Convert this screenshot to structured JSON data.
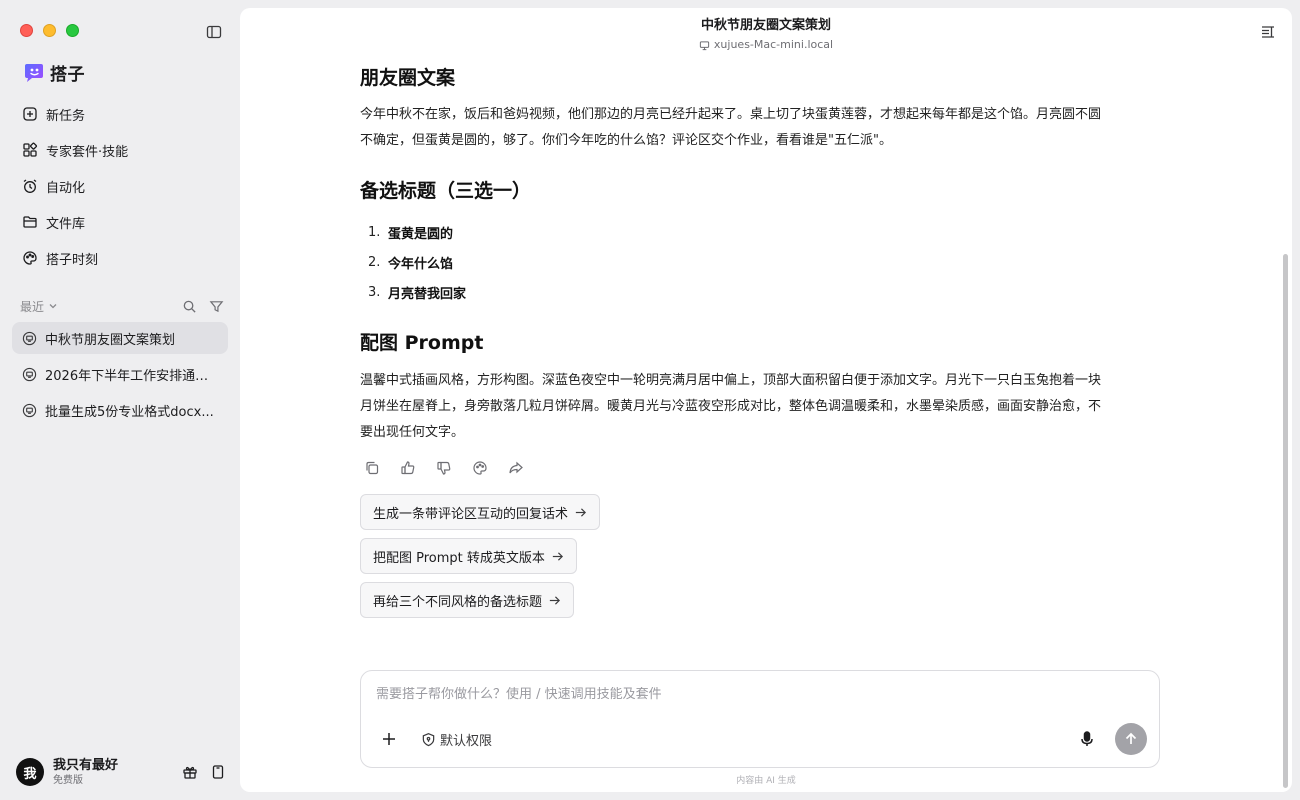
{
  "sidebar": {
    "app_name": "搭子",
    "nav": [
      {
        "label": "新任务",
        "icon": "new-task-icon"
      },
      {
        "label": "专家套件·技能",
        "icon": "widgets-icon"
      },
      {
        "label": "自动化",
        "icon": "alarm-clock-icon"
      },
      {
        "label": "文件库",
        "icon": "folder-icon"
      },
      {
        "label": "搭子时刻",
        "icon": "palette-icon"
      }
    ],
    "recent_label": "最近",
    "history": [
      {
        "title": "中秋节朋友圈文案策划",
        "active": true
      },
      {
        "title": "2026年下半年工作安排通知..."
      },
      {
        "title": "批量生成5份专业格式docx..."
      }
    ],
    "user": {
      "avatar": "我",
      "name": "我只有最好",
      "plan": "免费版"
    }
  },
  "header": {
    "title": "中秋节朋友圈文案策划",
    "device": "xujues-Mac-mini.local"
  },
  "article": {
    "section1_title": "朋友圈文案",
    "section1_body_line1": "今年中秋不在家，饭后和爸妈视频，他们那边的月亮已经升起来了。桌上切了块蛋黄莲蓉，才想起来每年都是这个馅。月亮圆不圆",
    "section1_body_line2": "不确定，但蛋黄是圆的，够了。你们今年吃的什么馅？评论区交个作业，看看谁是\"五仁派\"。",
    "section2_title": "备选标题（三选一）",
    "titles": [
      {
        "num": "1.",
        "text": "蛋黄是圆的"
      },
      {
        "num": "2.",
        "text": "今年什么馅"
      },
      {
        "num": "3.",
        "text": "月亮替我回家"
      }
    ],
    "section3_title": "配图 Prompt",
    "section3_body_line1": "温馨中式插画风格，方形构图。深蓝色夜空中一轮明亮满月居中偏上，顶部大面积留白便于添加文字。月光下一只白玉兔抱着一块",
    "section3_body_line2": "月饼坐在屋脊上，身旁散落几粒月饼碎屑。暖黄月光与冷蓝夜空形成对比，整体色调温暖柔和，水墨晕染质感，画面安静治愈，不",
    "section3_body_line3": "要出现任何文字。"
  },
  "suggestions": [
    "生成一条带评论区互动的回复话术",
    "把配图 Prompt 转成英文版本",
    "再给三个不同风格的备选标题"
  ],
  "composer": {
    "placeholder": "需要搭子帮你做什么？使用 / 快速调用技能及套件",
    "permission_label": "默认权限"
  },
  "footnote": "内容由 AI 生成",
  "colors": {
    "accent": "#1c1c1e",
    "send_disabled": "#a3a3a8",
    "active_bg": "#e0e0e4"
  }
}
